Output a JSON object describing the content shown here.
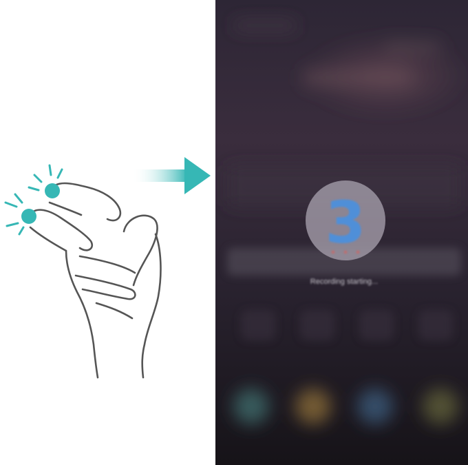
{
  "countdown": {
    "value": "3",
    "status": "Recording starting..."
  },
  "colors": {
    "accent": "#36b7b5",
    "countdown_digit": "#4f8fd8",
    "phone_bg": "#2f2535"
  },
  "icons": {
    "gesture": "double-knuckle-knock-icon",
    "arrow": "arrow-right-icon"
  }
}
